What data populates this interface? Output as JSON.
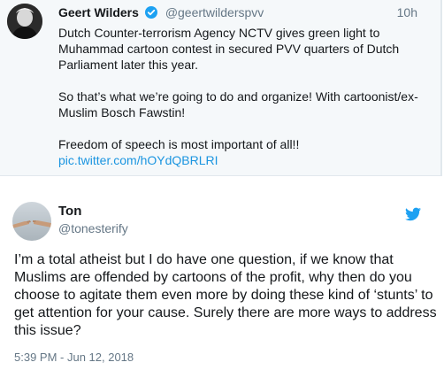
{
  "quoted_tweet": {
    "author_name": "Geert Wilders",
    "handle": "@geertwilderspvv",
    "time": "10h",
    "paragraphs": [
      "Dutch Counter-terrorism Agency NCTV gives green light to Muhammad cartoon contest in secured PVV quarters of Dutch Parliament later this year.",
      "So that’s what we’re going to do and organize! With cartoonist/ex-Muslim Bosch Fawstin!",
      "Freedom of speech is most important of all!!"
    ],
    "link": "pic.twitter.com/hOYdQBRLRI",
    "verified_icon": "verified-badge-icon"
  },
  "tweet": {
    "author_name": "Ton",
    "handle": "@tonesterify",
    "text": "I’m a total atheist but I do have one question, if we know that Muslims are offended by cartoons of the profit, why then do you choose to agitate them even more by doing these kind of ‘stunts’ to get attention for your cause. Surely there are more ways to address this issue?",
    "timestamp": "5:39 PM - Jun 12, 2018",
    "brand_icon": "twitter-bird-icon"
  },
  "colors": {
    "quoted_background": "#f5f8fa",
    "link": "#1b95e0",
    "twitter_blue": "#1da1f2",
    "muted_text": "#657786"
  }
}
